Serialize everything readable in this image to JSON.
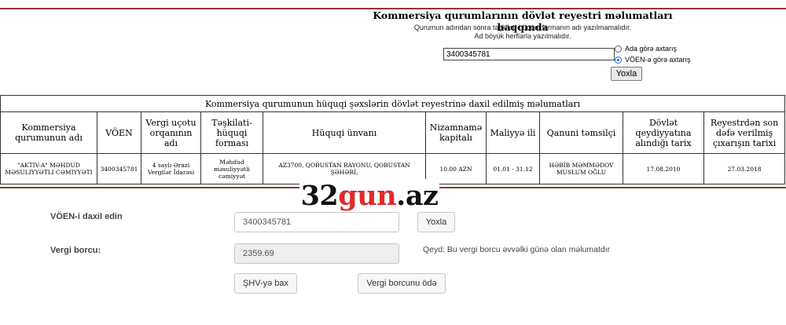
{
  "header": {
    "title": "Kommersiya qurumlarının dövlət reyestri məlumatları haqqında",
    "note1": "Qurumun adından sonra təşkilati-hüquqi formanın adı yazılmamalıdır.",
    "note2": "Ad böyük herflərlə yazılmalıdır."
  },
  "search": {
    "value": "3400345781",
    "radio_name": "Ada görə axtarış",
    "radio_voen": "VÖEN-ə görə axtarış",
    "selected": "voen",
    "button": "Yoxla"
  },
  "table": {
    "caption": "Kommersiya qurumunun hüquqi şəxslərin dövlət reyestrinə daxil edilmiş məlumatları",
    "headers": [
      "Kommersiya qurumunun adı",
      "VÖEN",
      "Vergi uçotu orqanının adı",
      "Təşkilati-hüquqi forması",
      "Hüquqi ünvanı",
      "Nizamnamə kapitalı",
      "Maliyyə ili",
      "Qanuni təmsilçi",
      "Dövlət qeydiyyatına alındığı tarix",
      "Reyestrdən son dəfə verilmiş çıxarışın tarixi"
    ],
    "row": [
      "\"AKTIV-A\" MƏHDUD MƏSULIYYƏTLI CƏMIYYƏTI",
      "3400345781",
      "4 saylı Ərazi Vergilər İdarəsi",
      "Məhdud məsuliyyətli cəmiyyət",
      "AZ3700, QOBUSTAN RAYONU, QOBUSTAN ŞƏHƏRİ,",
      "10.00 AZN",
      "01.01 - 31.12",
      "HƏBİB MƏMMƏDOV MUSLUM OĞLU",
      "17.08.2010",
      "27.03.2018"
    ]
  },
  "watermark": {
    "part1": "32",
    "part2": "gun",
    "part3": ".az"
  },
  "debt": {
    "voen_label": "VÖEN-i daxil edin",
    "voen_value": "3400345781",
    "check_button": "Yoxla",
    "debt_label": "Vergi borcu:",
    "debt_value": "2359.69",
    "note": "Qeyd: Bu vergi borcu əvvəlki günə olan məlumatdır",
    "shv_button": "ŞHV-yə bax",
    "pay_button": "Vergi borcunu ödə"
  }
}
